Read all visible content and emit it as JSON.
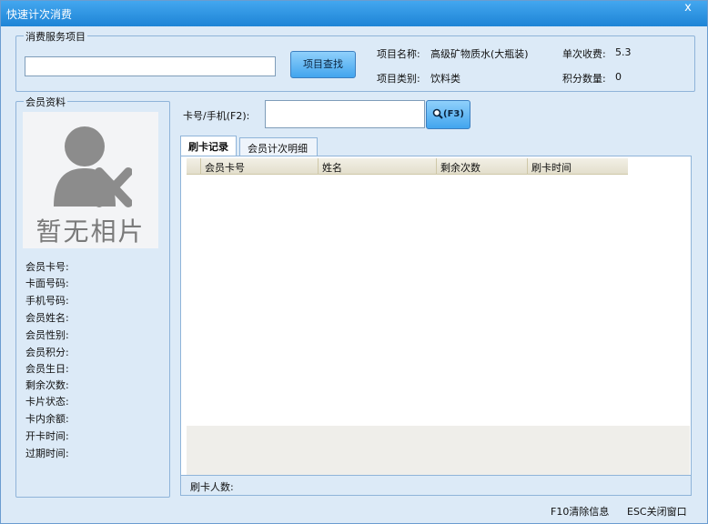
{
  "window": {
    "title": "快速计次消费",
    "close_glyph": "x"
  },
  "service": {
    "legend": "消费服务项目",
    "search_value": "",
    "search_button": "项目查找",
    "item_name_label": "项目名称:",
    "item_name_value": "高级矿物质水(大瓶装)",
    "unit_price_label": "单次收费:",
    "unit_price_value": "5.3",
    "item_type_label": "项目类别:",
    "item_type_value": "饮料类",
    "points_label": "积分数量:",
    "points_value": "0"
  },
  "member": {
    "legend": "会员资料",
    "no_photo": "暂无相片",
    "fields": [
      "会员卡号:",
      "卡面号码:",
      "手机号码:",
      "会员姓名:",
      "会员性别:",
      "会员积分:",
      "会员生日:",
      "剩余次数:",
      "卡片状态:",
      "卡内余额:",
      "开卡时间:",
      "过期时间:"
    ]
  },
  "card": {
    "label": "卡号/手机(F2):",
    "value": "",
    "search_button": "(F3)"
  },
  "tabs": [
    "刷卡记录",
    "会员计次明细"
  ],
  "table": {
    "columns": [
      "会员卡号",
      "姓名",
      "剩余次数",
      "刷卡时间"
    ]
  },
  "status": {
    "swipe_count_label": "刷卡人数:"
  },
  "footer": {
    "clear": "F10清除信息",
    "close": "ESC关闭窗口"
  },
  "colors": {
    "title_bar": "#1e84d6",
    "panel": "#dceaf7",
    "button": "#42a5ee"
  }
}
